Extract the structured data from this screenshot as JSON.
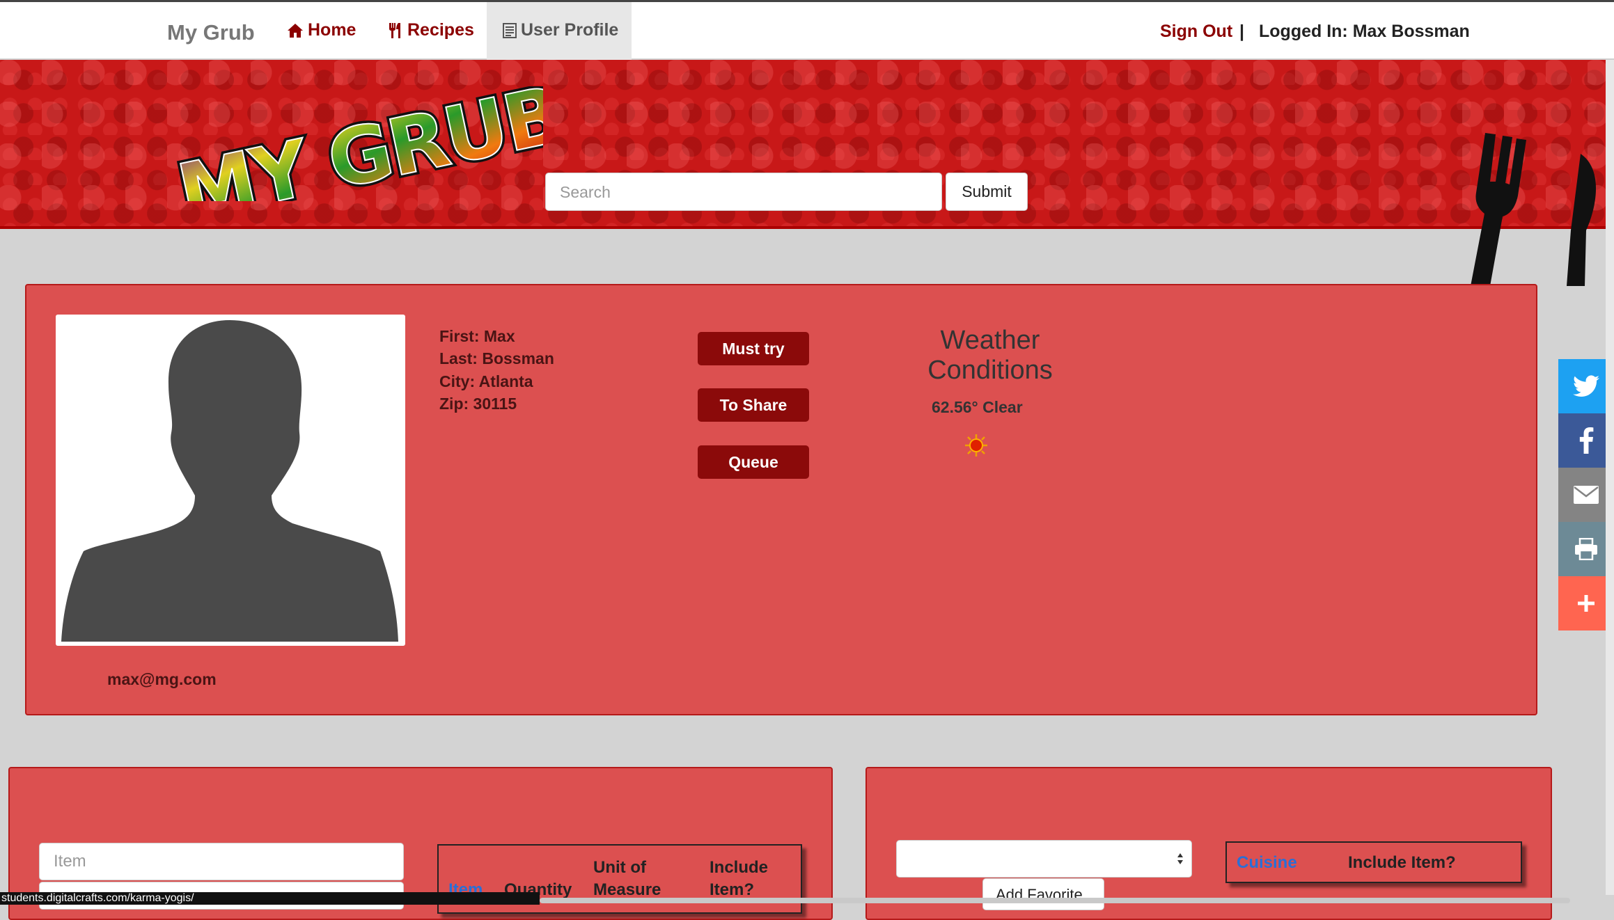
{
  "nav": {
    "brand": "My Grub",
    "home_label": "Home",
    "recipes_label": "Recipes",
    "profile_label": "User Profile",
    "signout_label": "Sign Out",
    "separator": "|",
    "logged_in": "Logged In: Max Bossman"
  },
  "header": {
    "search_placeholder": "Search",
    "submit_label": "Submit"
  },
  "profile": {
    "first": "First: Max",
    "last": "Last: Bossman",
    "city": "City: Atlanta",
    "zip": "Zip: 30115",
    "email": "max@mg.com",
    "buttons": {
      "must_try": "Must try",
      "to_share": "To Share",
      "queue": "Queue"
    },
    "weather_title": "Weather Conditions",
    "weather_value": "62.56° Clear"
  },
  "shopping": {
    "item_placeholder": "Item",
    "headers": [
      "Item",
      "Quantity",
      "Unit of Measure",
      "Include Item?"
    ]
  },
  "favorites": {
    "add_label": "Add Favorite",
    "headers": [
      "Cuisine",
      "Include Item?"
    ]
  },
  "status_url": "students.digitalcrafts.com/karma-yogis/",
  "colors": {
    "brand_red": "#8b0000",
    "panel": "#dc5050",
    "twitter": "#1da1f2",
    "facebook": "#3b5998",
    "email": "#848484",
    "print": "#6d8a96",
    "more": "#ff6550"
  },
  "social_icons": [
    "twitter-icon",
    "facebook-icon",
    "email-icon",
    "print-icon",
    "plus-icon"
  ]
}
